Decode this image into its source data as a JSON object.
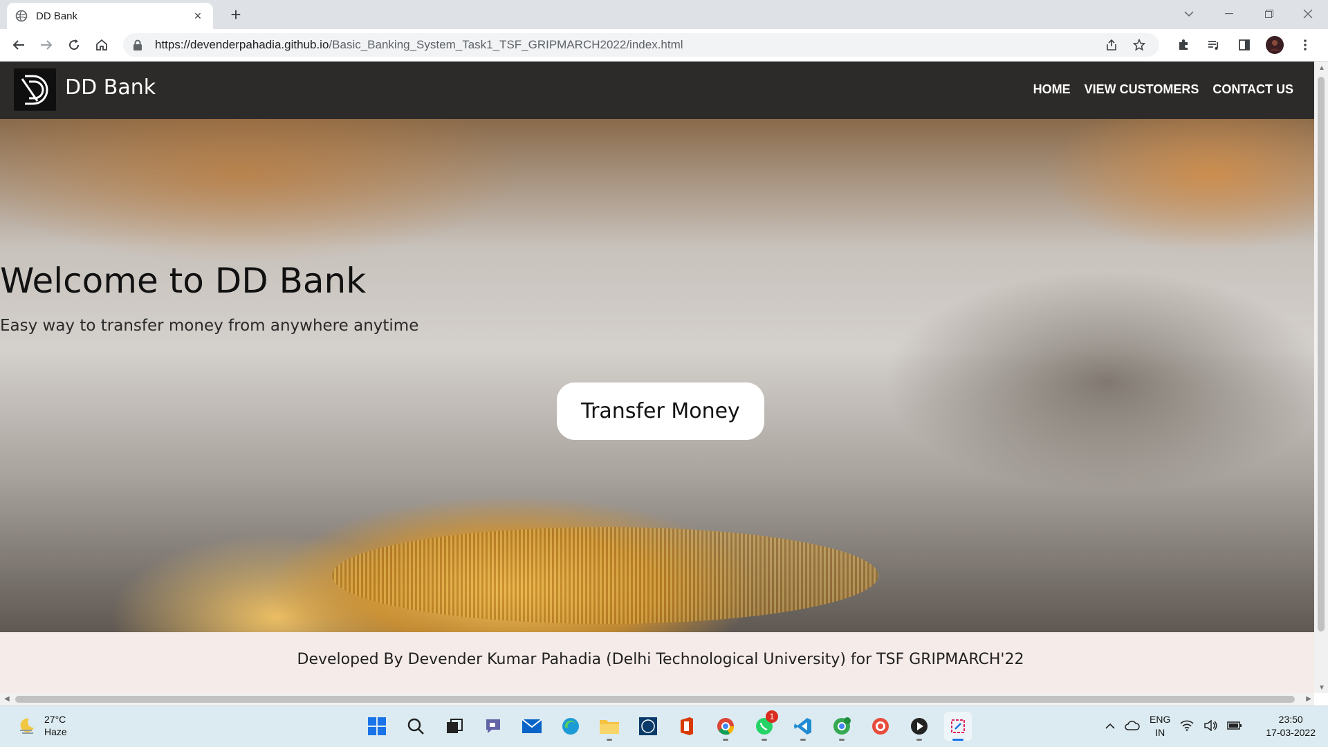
{
  "browser": {
    "tab_title": "DD Bank",
    "tab_close": "×",
    "new_tab": "+",
    "url_host": "https://devenderpahadia.github.io",
    "url_path": "/Basic_Banking_System_Task1_TSF_GRIPMARCH2022/index.html"
  },
  "site": {
    "brand": "DD Bank",
    "nav": [
      "HOME",
      "VIEW CUSTOMERS",
      "CONTACT US"
    ],
    "hero_title": "Welcome to DD Bank",
    "hero_subtitle": "Easy way to transfer money from anywhere anytime",
    "cta_label": "Transfer Money",
    "footer_text": "Developed By Devender Kumar Pahadia (Delhi Technological University) for TSF GRIPMARCH'22"
  },
  "taskbar": {
    "weather_temp": "27°C",
    "weather_desc": "Haze",
    "whatsapp_badge": "1",
    "lang_top": "ENG",
    "lang_bottom": "IN",
    "time": "23:50",
    "date": "17-03-2022"
  },
  "colors": {
    "site_nav_bg": "#2d2b2a",
    "footer_bg": "#f5ebe8",
    "taskbar_bg": "#dcebf1"
  }
}
